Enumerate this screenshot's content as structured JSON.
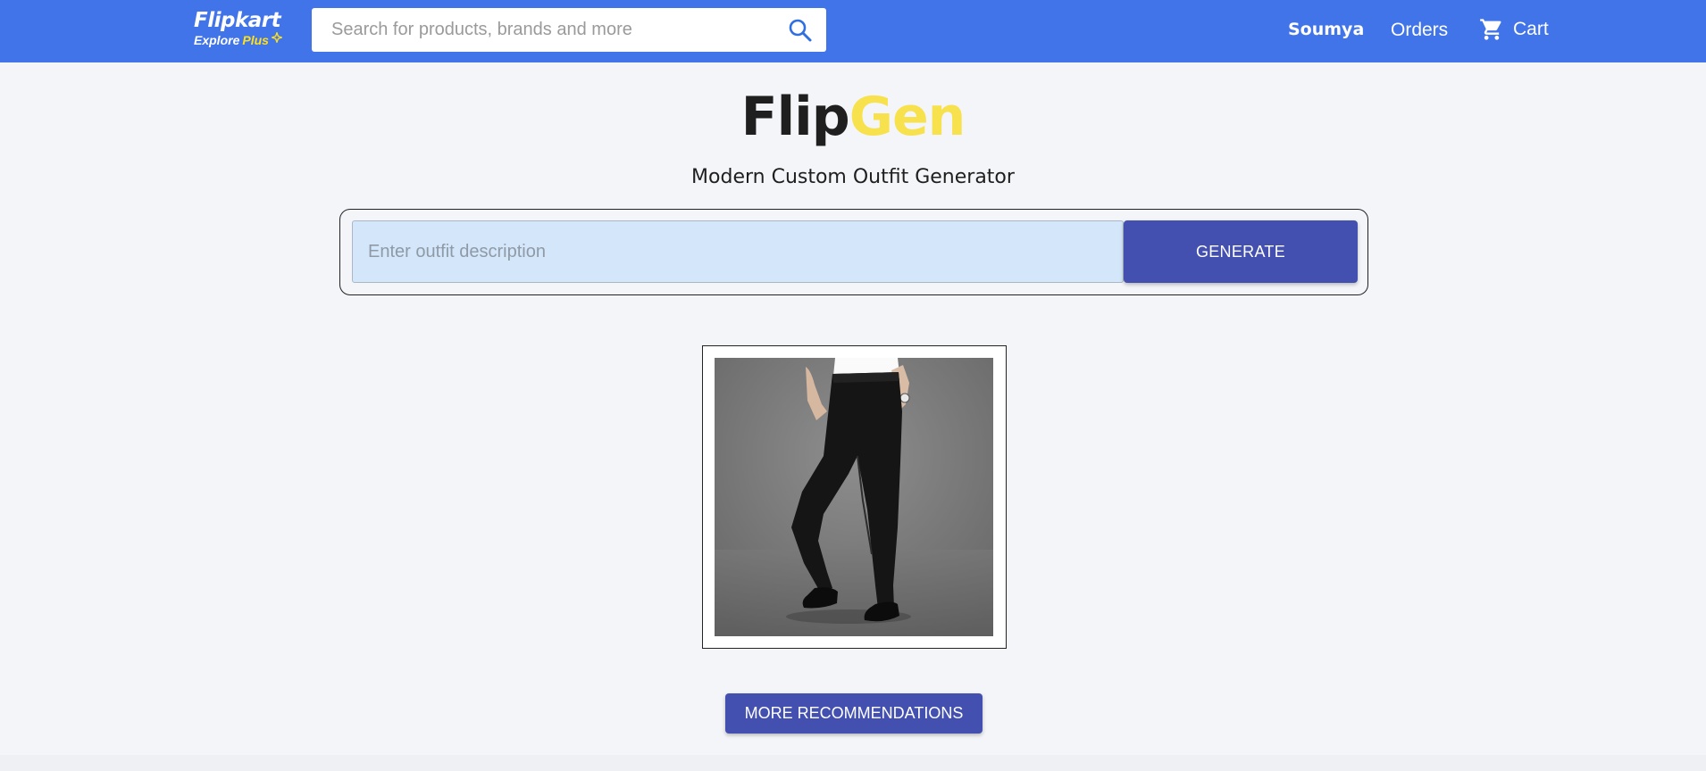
{
  "navbar": {
    "logo": {
      "name": "Flipkart",
      "sub_explore": "Explore",
      "sub_plus": "Plus"
    },
    "search": {
      "placeholder": "Search for products, brands and more",
      "value": ""
    },
    "user_label": "Soumya",
    "orders_label": "Orders",
    "cart_label": "Cart",
    "icons": [
      "search-icon",
      "cart-icon",
      "plus-star-icon"
    ],
    "colors": {
      "bar": "#4174e8",
      "plus": "#ffe11b"
    }
  },
  "main": {
    "brand": {
      "part1": "Flip",
      "part2": "Gen"
    },
    "subtitle": "Modern Custom Outfit Generator",
    "outfit_input": {
      "placeholder": "Enter outfit description",
      "value": ""
    },
    "generate_label": "GENERATE",
    "more_label": "MORE RECOMMENDATIONS",
    "colors": {
      "brand_accent": "#f7e14c",
      "button": "#4350b0",
      "input_bg": "#d3e6fa"
    }
  }
}
